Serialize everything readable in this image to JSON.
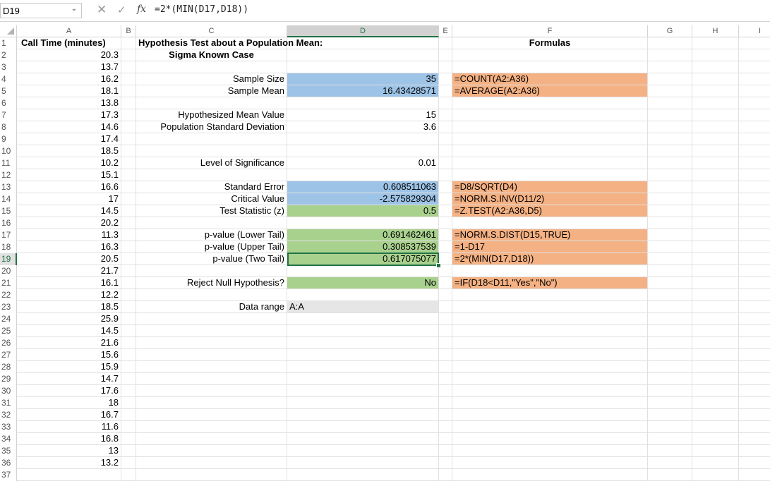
{
  "formula_bar": {
    "name_box": "D19",
    "formula": "=2*(MIN(D17,D18))"
  },
  "columns": [
    "A",
    "B",
    "C",
    "D",
    "E",
    "F",
    "G",
    "H",
    "I"
  ],
  "rows": [
    "1",
    "2",
    "3",
    "4",
    "5",
    "6",
    "7",
    "8",
    "9",
    "10",
    "11",
    "12",
    "13",
    "14",
    "15",
    "16",
    "17",
    "18",
    "19",
    "20",
    "21",
    "22",
    "23",
    "24",
    "25",
    "26",
    "27",
    "28",
    "29",
    "30",
    "31",
    "32",
    "33",
    "34",
    "35",
    "36",
    "37"
  ],
  "active_cell": {
    "column": "D",
    "row": "19"
  },
  "column_a": {
    "header": "Call Time (minutes)",
    "values": [
      "20.3",
      "13.7",
      "16.2",
      "18.1",
      "13.8",
      "17.3",
      "14.6",
      "17.4",
      "18.5",
      "10.2",
      "15.1",
      "16.6",
      "17",
      "14.5",
      "20.2",
      "11.3",
      "16.3",
      "20.5",
      "21.7",
      "16.1",
      "12.2",
      "18.5",
      "25.9",
      "14.5",
      "21.6",
      "15.6",
      "15.9",
      "14.7",
      "17.6",
      "18",
      "16.7",
      "11.6",
      "16.8",
      "13",
      "13.2"
    ]
  },
  "title": {
    "line1": "Hypothesis Test about a Population Mean:",
    "line2": "Sigma Known Case"
  },
  "formulas_header": "Formulas",
  "labels": {
    "sample_size": "Sample Size",
    "sample_mean": "Sample Mean",
    "hyp_mean": "Hypothesized Mean Value",
    "pop_sd": "Population Standard Deviation",
    "significance": "Level of Significance",
    "std_error": "Standard Error",
    "critical": "Critical Value",
    "test_stat": "Test Statistic (z)",
    "p_lower": "p-value (Lower Tail)",
    "p_upper": "p-value (Upper Tail)",
    "p_two": "p-value (Two Tail)",
    "reject": "Reject Null Hypothesis?",
    "data_range": "Data range"
  },
  "values": {
    "sample_size": "35",
    "sample_mean": "16.43428571",
    "hyp_mean": "15",
    "pop_sd": "3.6",
    "significance": "0.01",
    "std_error": "0.608511063",
    "critical": "-2.575829304",
    "test_stat": "0.5",
    "p_lower": "0.691462461",
    "p_upper": "0.308537539",
    "p_two": "0.617075077",
    "reject": "No",
    "data_range": "A:A"
  },
  "formulas": {
    "sample_size": "=COUNT(A2:A36)",
    "sample_mean": "=AVERAGE(A2:A36)",
    "std_error": "=D8/SQRT(D4)",
    "critical": "=NORM.S.INV(D11/2)",
    "test_stat": "=Z.TEST(A2:A36,D5)",
    "p_lower": "=NORM.S.DIST(D15,TRUE)",
    "p_upper": "=1-D17",
    "p_two": "=2*(MIN(D17,D18))",
    "reject": "=IF(D18<D11,\"Yes\",\"No\")"
  },
  "colors": {
    "input_blue": "#9dc3e6",
    "output_green": "#a9d18e",
    "formula_orange": "#f4b183",
    "range_gray": "#e7e6e6",
    "excel_green": "#217346"
  },
  "icons": {
    "cancel": "close-icon",
    "enter": "check-icon",
    "function": "fx-icon"
  }
}
